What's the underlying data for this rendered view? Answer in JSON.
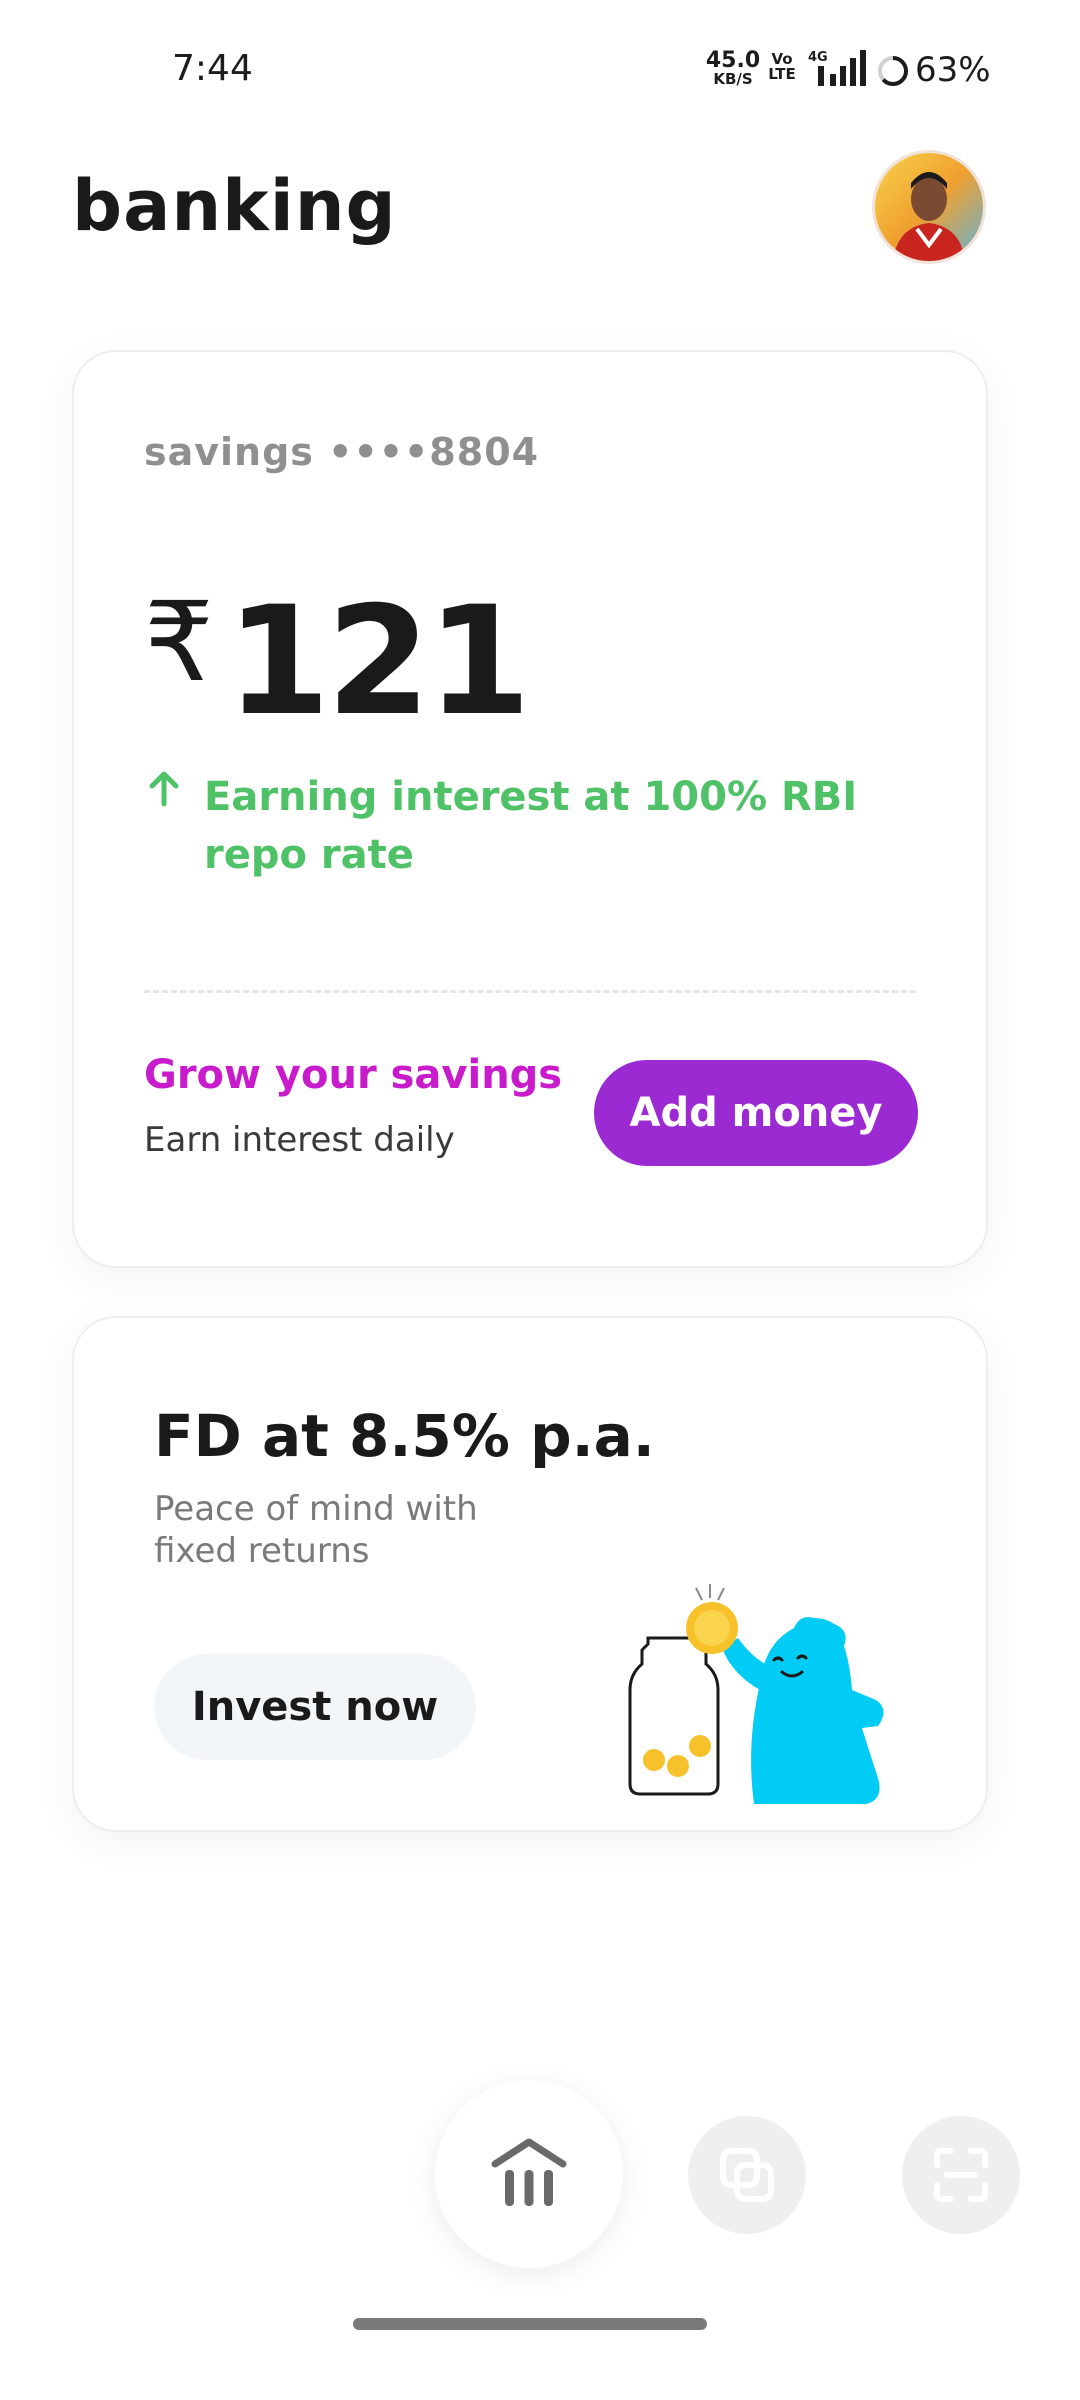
{
  "status_bar": {
    "time": "7:44",
    "net_speed_value": "45.0",
    "net_speed_unit": "KB/S",
    "volte_top": "Vo",
    "volte_bottom": "LTE",
    "network": "4G",
    "battery_percent": "63%"
  },
  "header": {
    "title": "banking"
  },
  "savings_card": {
    "account_label": "savings ••••8804",
    "currency_symbol": "₹",
    "balance": "121",
    "interest_text": "Earning interest at 100% RBI repo rate",
    "grow_title": "Grow your savings",
    "grow_subtitle": "Earn interest daily",
    "add_money_label": "Add money"
  },
  "fd_card": {
    "title": "FD at 8.5% p.a.",
    "subtitle": "Peace of mind with fixed returns",
    "invest_label": "Invest now"
  },
  "bottom_nav": {
    "items": [
      "home-bank-icon",
      "cards-icon",
      "scan-icon"
    ]
  },
  "colors": {
    "accent_purple": "#9c2ad3",
    "grow_magenta": "#c81bcb",
    "interest_green": "#4fc167",
    "mascot_cyan": "#00ccf5"
  }
}
